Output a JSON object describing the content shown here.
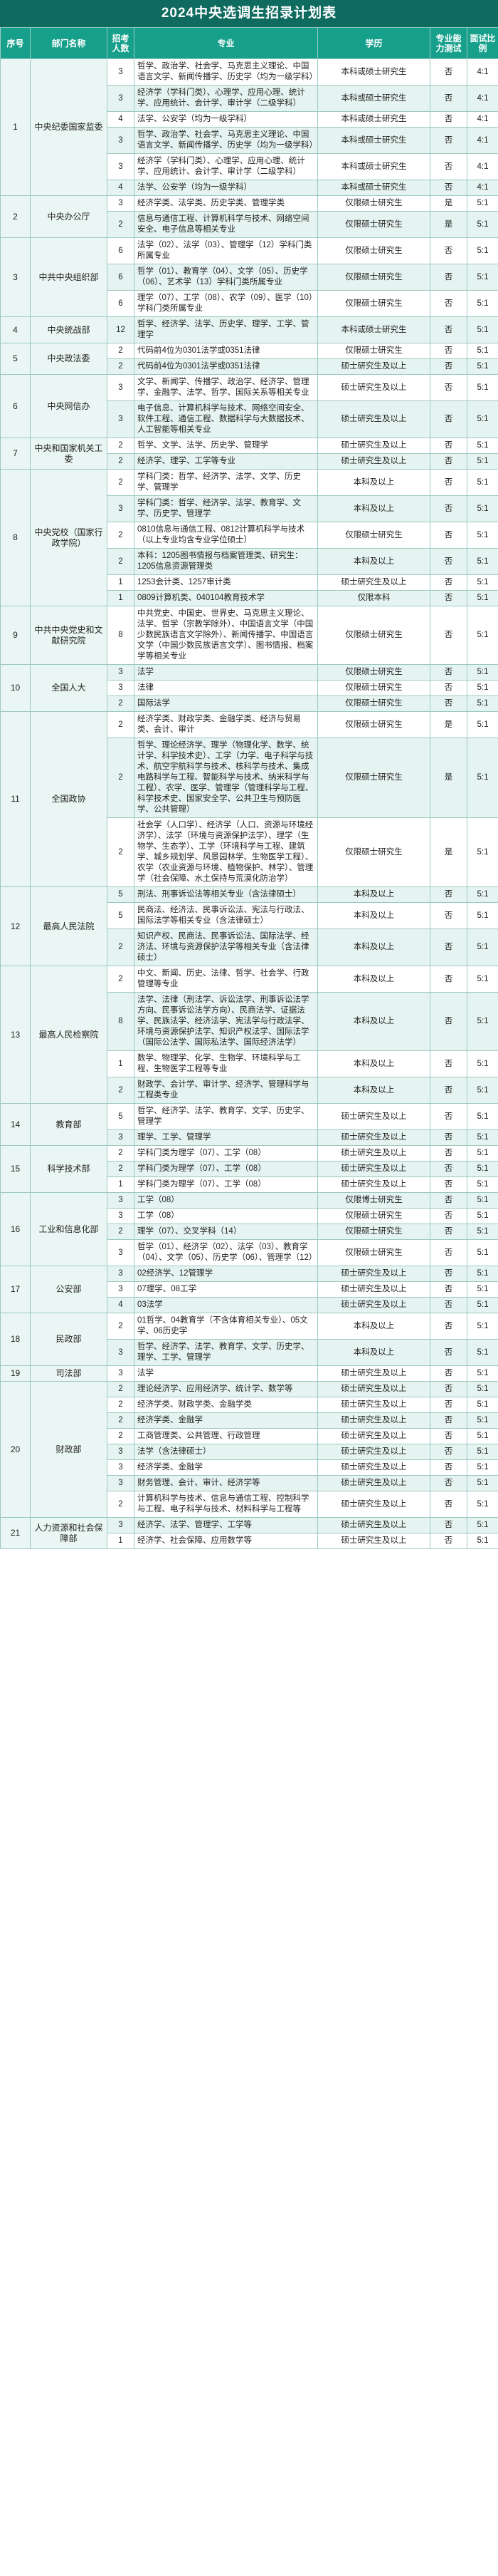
{
  "title": "2024中央选调生招录计划表",
  "headers": [
    "序号",
    "部门名称",
    "招考人数",
    "专业",
    "学历",
    "专业能力测试",
    "面试比例"
  ],
  "departments": [
    {
      "seq": "1",
      "name": "中央纪委国家监委",
      "rows": [
        {
          "num": "3",
          "major": "哲学、政治学、社会学、马克思主义理论、中国语言文学、新闻传播学、历史学（均为一级学科）",
          "degree": "本科或硕士研究生",
          "test": "否",
          "ratio": "4:1"
        },
        {
          "num": "3",
          "major": "经济学（学科门类）、心理学、应用心理、统计学、应用统计、会计学、审计学（二级学科）",
          "degree": "本科或硕士研究生",
          "test": "否",
          "ratio": "4:1"
        },
        {
          "num": "4",
          "major": "法学、公安学（均为一级学科）",
          "degree": "本科或硕士研究生",
          "test": "否",
          "ratio": "4:1"
        },
        {
          "num": "3",
          "major": "哲学、政治学、社会学、马克思主义理论、中国语言文学、新闻传播学、历史学（均为一级学科）",
          "degree": "本科或硕士研究生",
          "test": "否",
          "ratio": "4:1"
        },
        {
          "num": "3",
          "major": "经济学（学科门类）、心理学、应用心理、统计学、应用统计、会计学、审计学（二级学科）",
          "degree": "本科或硕士研究生",
          "test": "否",
          "ratio": "4:1"
        },
        {
          "num": "4",
          "major": "法学、公安学（均为一级学科）",
          "degree": "本科或硕士研究生",
          "test": "否",
          "ratio": "4:1"
        }
      ]
    },
    {
      "seq": "2",
      "name": "中央办公厅",
      "rows": [
        {
          "num": "3",
          "major": "经济学类、法学类、历史学类、管理学类",
          "degree": "仅限硕士研究生",
          "test": "是",
          "ratio": "5:1"
        },
        {
          "num": "2",
          "major": "信息与通信工程、计算机科学与技术、网络空间安全、电子信息等相关专业",
          "degree": "仅限硕士研究生",
          "test": "是",
          "ratio": "5:1"
        }
      ]
    },
    {
      "seq": "3",
      "name": "中共中央组织部",
      "rows": [
        {
          "num": "6",
          "major": "法学（02）、法学（03）、管理学（12）学科门类所属专业",
          "degree": "仅限硕士研究生",
          "test": "否",
          "ratio": "5:1"
        },
        {
          "num": "6",
          "major": "哲学（01）、教育学（04）、文学（05）、历史学（06）、艺术学（13）学科门类所属专业",
          "degree": "仅限硕士研究生",
          "test": "否",
          "ratio": "5:1"
        },
        {
          "num": "6",
          "major": "理学（07）、工学（08）、农学（09）、医学（10）学科门类所属专业",
          "degree": "仅限硕士研究生",
          "test": "否",
          "ratio": "5:1"
        }
      ]
    },
    {
      "seq": "4",
      "name": "中央统战部",
      "rows": [
        {
          "num": "12",
          "major": "哲学、经济学、法学、历史学、理学、工学、管理学",
          "degree": "本科或硕士研究生",
          "test": "否",
          "ratio": "5:1"
        }
      ]
    },
    {
      "seq": "5",
      "name": "中央政法委",
      "rows": [
        {
          "num": "2",
          "major": "代码前4位为0301法学或0351法律",
          "degree": "仅限硕士研究生",
          "test": "否",
          "ratio": "5:1"
        },
        {
          "num": "2",
          "major": "代码前4位为0301法学或0351法律",
          "degree": "硕士研究生及以上",
          "test": "否",
          "ratio": "5:1"
        }
      ]
    },
    {
      "seq": "6",
      "name": "中央网信办",
      "rows": [
        {
          "num": "3",
          "major": "文学、新闻学、传播学、政治学、经济学、管理学、金融学、法学、哲学、国际关系等相关专业",
          "degree": "硕士研究生及以上",
          "test": "否",
          "ratio": "5:1"
        },
        {
          "num": "3",
          "major": "电子信息、计算机科学与技术、网络空间安全、软件工程、通信工程、数据科学与大数据技术、人工智能等相关专业",
          "degree": "硕士研究生及以上",
          "test": "否",
          "ratio": "5:1"
        }
      ]
    },
    {
      "seq": "7",
      "name": "中央和国家机关工委",
      "rows": [
        {
          "num": "2",
          "major": "哲学、文学、法学、历史学、管理学",
          "degree": "硕士研究生及以上",
          "test": "否",
          "ratio": "5:1"
        },
        {
          "num": "2",
          "major": "经济学、理学、工学等专业",
          "degree": "硕士研究生及以上",
          "test": "否",
          "ratio": "5:1"
        }
      ]
    },
    {
      "seq": "8",
      "name": "中央党校（国家行政学院）",
      "rows": [
        {
          "num": "2",
          "major": "学科门类：哲学、经济学、法学、文学、历史学、管理学",
          "degree": "本科及以上",
          "test": "否",
          "ratio": "5:1"
        },
        {
          "num": "3",
          "major": "学科门类：哲学、经济学、法学、教育学、文学、历史学、管理学",
          "degree": "本科及以上",
          "test": "否",
          "ratio": "5:1"
        },
        {
          "num": "2",
          "major": "0810信息与通信工程、0812计算机科学与技术（以上专业均含专业学位硕士）",
          "degree": "仅限硕士研究生",
          "test": "否",
          "ratio": "5:1"
        },
        {
          "num": "2",
          "major": "本科：1205图书情报与档案管理类、研究生：1205信息资源管理类",
          "degree": "本科及以上",
          "test": "否",
          "ratio": "5:1"
        },
        {
          "num": "1",
          "major": "1253会计类、1257审计类",
          "degree": "硕士研究生及以上",
          "test": "否",
          "ratio": "5:1"
        },
        {
          "num": "1",
          "major": "0809计算机类、040104教育技术学",
          "degree": "仅限本科",
          "test": "否",
          "ratio": "5:1"
        }
      ]
    },
    {
      "seq": "9",
      "name": "中共中央党史和文献研究院",
      "rows": [
        {
          "num": "8",
          "major": "中共党史、中国史、世界史、马克思主义理论、法学、哲学（宗教学除外）、中国语言文学（中国少数民族语言文学除外）、新闻传播学、中国语言文学（中国少数民族语言文学）、图书情报、档案学等相关专业",
          "degree": "仅限硕士研究生",
          "test": "否",
          "ratio": "5:1"
        }
      ]
    },
    {
      "seq": "10",
      "name": "全国人大",
      "rows": [
        {
          "num": "3",
          "major": "法学",
          "degree": "仅限硕士研究生",
          "test": "否",
          "ratio": "5:1"
        },
        {
          "num": "3",
          "major": "法律",
          "degree": "仅限硕士研究生",
          "test": "否",
          "ratio": "5:1"
        },
        {
          "num": "2",
          "major": "国际法学",
          "degree": "仅限硕士研究生",
          "test": "否",
          "ratio": "5:1"
        }
      ]
    },
    {
      "seq": "11",
      "name": "全国政协",
      "rows": [
        {
          "num": "2",
          "major": "经济学类、财政学类、金融学类、经济与贸易类、会计、审计",
          "degree": "仅限硕士研究生",
          "test": "是",
          "ratio": "5:1"
        },
        {
          "num": "2",
          "major": "哲学、理论经济学、理学（物理化学、数学、统计学、科学技术史）、工学（力学、电子科学与技术、航空宇航科学与技术、核科学与技术、集成电路科学与工程、智能科学与技术、纳米科学与工程）、农学、医学、管理学（管理科学与工程、科学技术史、国家安全学、公共卫生与预防医学、公共管理）",
          "degree": "仅限硕士研究生",
          "test": "是",
          "ratio": "5:1"
        },
        {
          "num": "2",
          "major": "社会学（人口学）、经济学（人口、资源与环境经济学）、法学（环境与资源保护法学）、理学（生物学、生态学）、工学（环境科学与工程、建筑学、城乡规划学、风景园林学、生物医学工程）、农学（农业资源与环境、植物保护、林学）、管理学（社会保障、水土保持与荒漠化防治学）",
          "degree": "仅限硕士研究生",
          "test": "是",
          "ratio": "5:1"
        }
      ]
    },
    {
      "seq": "12",
      "name": "最高人民法院",
      "rows": [
        {
          "num": "5",
          "major": "刑法、刑事诉讼法等相关专业（含法律硕士）",
          "degree": "本科及以上",
          "test": "否",
          "ratio": "5:1"
        },
        {
          "num": "5",
          "major": "民商法、经济法、民事诉讼法、宪法与行政法、国际法学等相关专业（含法律硕士）",
          "degree": "本科及以上",
          "test": "否",
          "ratio": "5:1"
        },
        {
          "num": "2",
          "major": "知识产权、民商法、民事诉讼法、国际法学、经济法、环境与资源保护法学等相关专业（含法律硕士）",
          "degree": "本科及以上",
          "test": "否",
          "ratio": "5:1"
        }
      ]
    },
    {
      "seq": "13",
      "name": "最高人民检察院",
      "rows": [
        {
          "num": "2",
          "major": "中文、新闻、历史、法律、哲学、社会学、行政管理等专业",
          "degree": "本科及以上",
          "test": "否",
          "ratio": "5:1"
        },
        {
          "num": "8",
          "major": "法学、法律（刑法学、诉讼法学、刑事诉讼法学方向、民事诉讼法学方向）、民商法学、证据法学、民族法学、经济法学、宪法学与行政法学、环境与资源保护法学、知识产权法学、国际法学（国际公法学、国际私法学、国际经济法学）",
          "degree": "本科及以上",
          "test": "否",
          "ratio": "5:1"
        },
        {
          "num": "1",
          "major": "数学、物理学、化学、生物学、环境科学与工程、生物医学工程等专业",
          "degree": "本科及以上",
          "test": "否",
          "ratio": "5:1"
        },
        {
          "num": "2",
          "major": "财政学、会计学、审计学、经济学、管理科学与工程类专业",
          "degree": "本科及以上",
          "test": "否",
          "ratio": "5:1"
        }
      ]
    },
    {
      "seq": "14",
      "name": "教育部",
      "rows": [
        {
          "num": "5",
          "major": "哲学、经济学、法学、教育学、文学、历史学、管理学",
          "degree": "硕士研究生及以上",
          "test": "否",
          "ratio": "5:1"
        },
        {
          "num": "3",
          "major": "理学、工学、管理学",
          "degree": "硕士研究生及以上",
          "test": "否",
          "ratio": "5:1"
        }
      ]
    },
    {
      "seq": "15",
      "name": "科学技术部",
      "rows": [
        {
          "num": "2",
          "major": "学科门类为理学（07）、工学（08）",
          "degree": "硕士研究生及以上",
          "test": "否",
          "ratio": "5:1"
        },
        {
          "num": "2",
          "major": "学科门类为理学（07）、工学（08）",
          "degree": "硕士研究生及以上",
          "test": "否",
          "ratio": "5:1"
        },
        {
          "num": "1",
          "major": "学科门类为理学（07）、工学（08）",
          "degree": "硕士研究生及以上",
          "test": "否",
          "ratio": "5:1"
        }
      ]
    },
    {
      "seq": "16",
      "name": "工业和信息化部",
      "rows": [
        {
          "num": "3",
          "major": "工学（08）",
          "degree": "仅限博士研究生",
          "test": "否",
          "ratio": "5:1"
        },
        {
          "num": "3",
          "major": "工学（08）",
          "degree": "仅限硕士研究生",
          "test": "否",
          "ratio": "5:1"
        },
        {
          "num": "2",
          "major": "理学（07）、交叉学科（14）",
          "degree": "仅限硕士研究生",
          "test": "否",
          "ratio": "5:1"
        },
        {
          "num": "3",
          "major": "哲学（01）、经济学（02）、法学（03）、教育学（04）、文学（05）、历史学（06）、管理学（12）",
          "degree": "仅限硕士研究生",
          "test": "否",
          "ratio": "5:1"
        }
      ]
    },
    {
      "seq": "17",
      "name": "公安部",
      "rows": [
        {
          "num": "3",
          "major": "02经济学、12管理学",
          "degree": "硕士研究生及以上",
          "test": "否",
          "ratio": "5:1"
        },
        {
          "num": "3",
          "major": "07理学、08工学",
          "degree": "硕士研究生及以上",
          "test": "否",
          "ratio": "5:1"
        },
        {
          "num": "4",
          "major": "03法学",
          "degree": "硕士研究生及以上",
          "test": "否",
          "ratio": "5:1"
        }
      ]
    },
    {
      "seq": "18",
      "name": "民政部",
      "rows": [
        {
          "num": "2",
          "major": "01哲学、04教育学（不含体育相关专业）、05文学、06历史学",
          "degree": "本科及以上",
          "test": "否",
          "ratio": "5:1"
        },
        {
          "num": "3",
          "major": "哲学、经济学、法学、教育学、文学、历史学、理学、工学、管理学",
          "degree": "本科及以上",
          "test": "否",
          "ratio": "5:1"
        }
      ]
    },
    {
      "seq": "19",
      "name": "司法部",
      "rows": [
        {
          "num": "3",
          "major": "法学",
          "degree": "硕士研究生及以上",
          "test": "否",
          "ratio": "5:1"
        }
      ]
    },
    {
      "seq": "20",
      "name": "财政部",
      "rows": [
        {
          "num": "2",
          "major": "理论经济学、应用经济学、统计学、数学等",
          "degree": "硕士研究生及以上",
          "test": "否",
          "ratio": "5:1"
        },
        {
          "num": "2",
          "major": "经济学类、财政学类、金融学类",
          "degree": "硕士研究生及以上",
          "test": "否",
          "ratio": "5:1"
        },
        {
          "num": "2",
          "major": "经济学类、金融学",
          "degree": "硕士研究生及以上",
          "test": "否",
          "ratio": "5:1"
        },
        {
          "num": "2",
          "major": "工商管理类、公共管理、行政管理",
          "degree": "硕士研究生及以上",
          "test": "否",
          "ratio": "5:1"
        },
        {
          "num": "3",
          "major": "法学（含法律硕士）",
          "degree": "硕士研究生及以上",
          "test": "否",
          "ratio": "5:1"
        },
        {
          "num": "3",
          "major": "经济学类、金融学",
          "degree": "硕士研究生及以上",
          "test": "否",
          "ratio": "5:1"
        },
        {
          "num": "3",
          "major": "财务管理、会计、审计、经济学等",
          "degree": "硕士研究生及以上",
          "test": "否",
          "ratio": "5:1"
        },
        {
          "num": "2",
          "major": "计算机科学与技术、信息与通信工程、控制科学与工程、电子科学与技术、材料科学与工程等",
          "degree": "硕士研究生及以上",
          "test": "否",
          "ratio": "5:1"
        }
      ]
    },
    {
      "seq": "21",
      "name": "人力资源和社会保障部",
      "rows": [
        {
          "num": "3",
          "major": "经济学、法学、管理学、工学等",
          "degree": "硕士研究生及以上",
          "test": "否",
          "ratio": "5:1"
        },
        {
          "num": "1",
          "major": "经济学、社会保障、应用数学等",
          "degree": "硕士研究生及以上",
          "test": "否",
          "ratio": "5:1"
        }
      ]
    }
  ]
}
